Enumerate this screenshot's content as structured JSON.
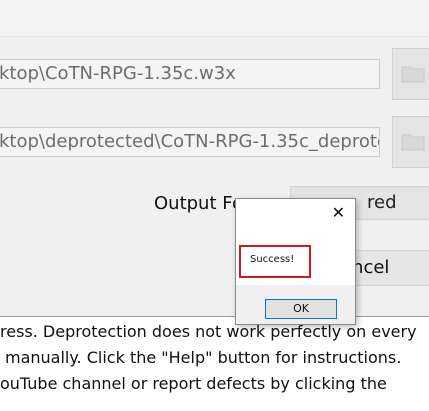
{
  "input_path": "ktop\\CoTN-RPG-1.35c.w3x",
  "output_path": "ktop\\deprotected\\CoTN-RPG-1.35c_deprotect",
  "icons": {
    "browse_input": "folder-icon",
    "browse_output": "folder-icon",
    "close": "close-icon"
  },
  "output_format": {
    "label": "Output Fo",
    "selected": "red"
  },
  "cancel_label": "ancel",
  "info_lines": [
    "ress. Deprotection does not work perfectly on every",
    "manually. Click the \"Help\" button for instructions.",
    "ouTube channel or report defects by clicking the"
  ],
  "dialog": {
    "close_glyph": "✕",
    "message": "Success!",
    "ok_label": "OK",
    "accent": "#0078d7",
    "highlight": "#d0191e"
  }
}
